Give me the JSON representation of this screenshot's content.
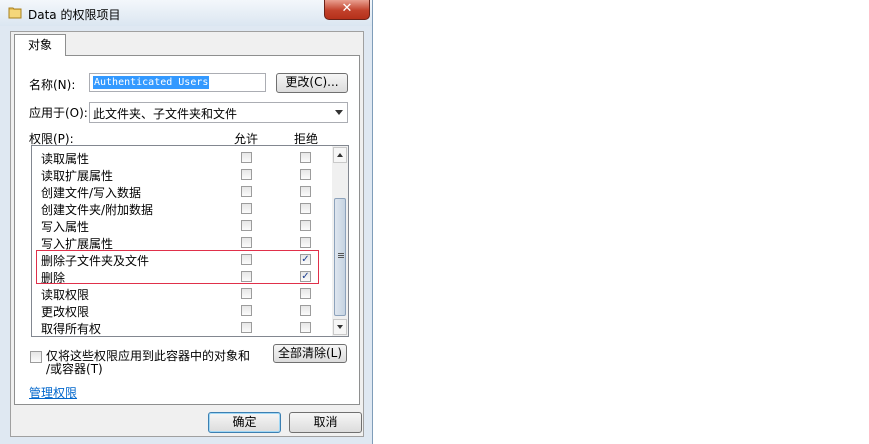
{
  "window": {
    "title": "Data 的权限项目",
    "close_symbol": "✕"
  },
  "tabs": [
    {
      "label": "对象"
    }
  ],
  "name_field": {
    "label": "名称(N):",
    "value": "Authenticated Users",
    "change_button": "更改(C)..."
  },
  "apply_to": {
    "label": "应用于(O):",
    "value": "此文件夹、子文件夹和文件"
  },
  "permissions": {
    "label": "权限(P):",
    "col_allow": "允许",
    "col_deny": "拒绝",
    "items": [
      {
        "name": "读取属性",
        "allow": false,
        "deny": false
      },
      {
        "name": "读取扩展属性",
        "allow": false,
        "deny": false
      },
      {
        "name": "创建文件/写入数据",
        "allow": false,
        "deny": false
      },
      {
        "name": "创建文件夹/附加数据",
        "allow": false,
        "deny": false
      },
      {
        "name": "写入属性",
        "allow": false,
        "deny": false
      },
      {
        "name": "写入扩展属性",
        "allow": false,
        "deny": false
      },
      {
        "name": "删除子文件夹及文件",
        "allow": false,
        "deny": true
      },
      {
        "name": "删除",
        "allow": false,
        "deny": true
      },
      {
        "name": "读取权限",
        "allow": false,
        "deny": false
      },
      {
        "name": "更改权限",
        "allow": false,
        "deny": false
      },
      {
        "name": "取得所有权",
        "allow": false,
        "deny": false
      }
    ]
  },
  "apply_only": {
    "line1": "仅将这些权限应用到此容器中的对象和",
    "line2": "/或容器(T)",
    "checked": false
  },
  "clear_all_button": "全部清除(L)",
  "manage_link": "管理权限",
  "ok_button": "确定",
  "cancel_button": "取消",
  "check_symbol": "✓"
}
